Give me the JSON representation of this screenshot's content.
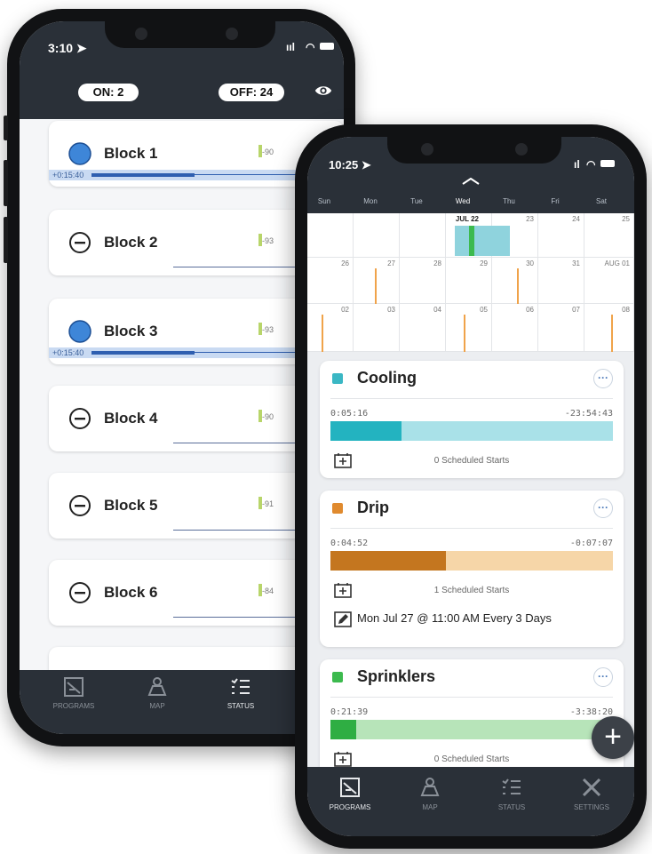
{
  "back_phone": {
    "status_time": "3:10",
    "on_count": "ON: 2",
    "off_count": "OFF: 24",
    "blocks": [
      {
        "name": "Block 1",
        "state": "on",
        "signal": "-90",
        "timer": "+0:15:40"
      },
      {
        "name": "Block 2",
        "state": "off",
        "signal": "-93"
      },
      {
        "name": "Block 3",
        "state": "on",
        "signal": "-93",
        "timer": "+0:15:40"
      },
      {
        "name": "Block 4",
        "state": "off",
        "signal": "-90"
      },
      {
        "name": "Block 5",
        "state": "off",
        "signal": "-91"
      },
      {
        "name": "Block 6",
        "state": "off",
        "signal": "-84"
      }
    ],
    "tabs": [
      "PROGRAMS",
      "MAP",
      "STATUS"
    ]
  },
  "front_phone": {
    "status_time": "10:25",
    "weekdays": [
      "Sun",
      "Mon",
      "Tue",
      "Wed",
      "Thu",
      "Fri",
      "Sat"
    ],
    "calendar": {
      "row1": [
        "",
        "",
        "",
        "JUL 22",
        "23",
        "24",
        "25"
      ],
      "row2": [
        "26",
        "27",
        "28",
        "29",
        "30",
        "31",
        "AUG 01"
      ],
      "row3": [
        "02",
        "03",
        "04",
        "05",
        "06",
        "07",
        "08"
      ]
    },
    "programs": [
      {
        "name": "Cooling",
        "color": "#3ab7c4",
        "elapsed": "0:05:16",
        "remaining": "-23:54:43",
        "progress": 0.25,
        "scheduled": "0 Scheduled Starts"
      },
      {
        "name": "Drip",
        "color": "#e08a2e",
        "elapsed": "0:04:52",
        "remaining": "-0:07:07",
        "progress": 0.41,
        "scheduled": "1 Scheduled Starts",
        "recurrence": "Mon Jul 27 @ 11:00 AM Every 3 Days"
      },
      {
        "name": "Sprinklers",
        "color": "#3cba4e",
        "elapsed": "0:21:39",
        "remaining": "-3:38:20",
        "progress": 0.09,
        "scheduled": "0 Scheduled Starts"
      }
    ],
    "more_label": "···",
    "fab_label": "+",
    "tabs": [
      "PROGRAMS",
      "MAP",
      "STATUS",
      "SETTINGS"
    ]
  }
}
